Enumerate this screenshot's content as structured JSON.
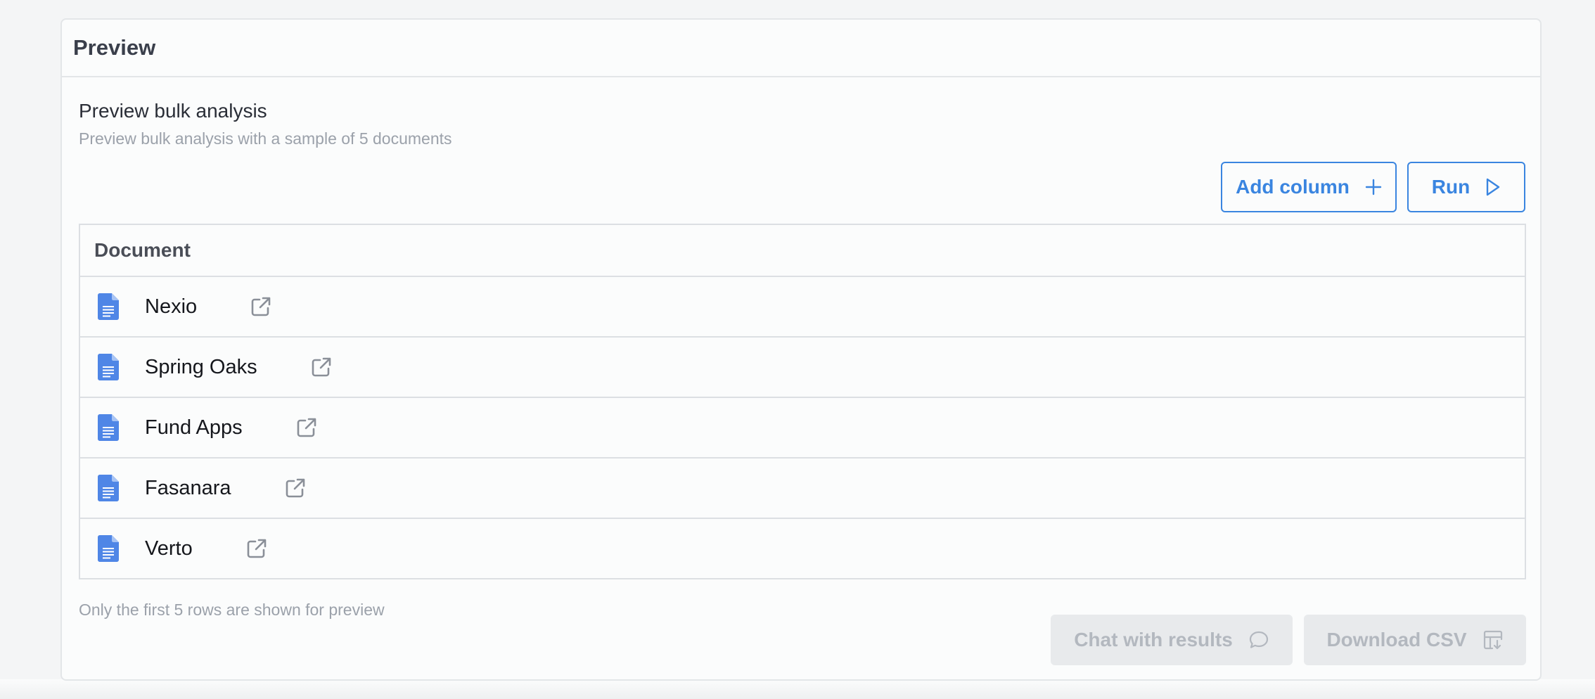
{
  "card": {
    "title": "Preview"
  },
  "section": {
    "title": "Preview bulk analysis",
    "subtitle": "Preview bulk analysis with a sample of 5 documents"
  },
  "actions": {
    "add_column_label": "Add column",
    "add_column_icon": "plus-icon",
    "run_label": "Run",
    "run_icon": "play-icon"
  },
  "table": {
    "header": "Document",
    "rows": [
      {
        "name": "Nexio",
        "icon": "google-doc-icon",
        "action_icon": "external-link-icon"
      },
      {
        "name": "Spring Oaks",
        "icon": "google-doc-icon",
        "action_icon": "external-link-icon"
      },
      {
        "name": "Fund Apps",
        "icon": "google-doc-icon",
        "action_icon": "external-link-icon"
      },
      {
        "name": "Fasanara",
        "icon": "google-doc-icon",
        "action_icon": "external-link-icon"
      },
      {
        "name": "Verto",
        "icon": "google-doc-icon",
        "action_icon": "external-link-icon"
      }
    ]
  },
  "footnote": "Only the first 5 rows are shown for preview",
  "footer_actions": {
    "chat_label": "Chat with results",
    "chat_icon": "chat-bubble-icon",
    "download_label": "Download CSV",
    "download_icon": "table-download-icon"
  },
  "colors": {
    "accent": "#3a85e0",
    "doc_icon": "#4f86e6",
    "disabled_bg": "#e8eaec",
    "disabled_text": "#b3b8bf"
  }
}
